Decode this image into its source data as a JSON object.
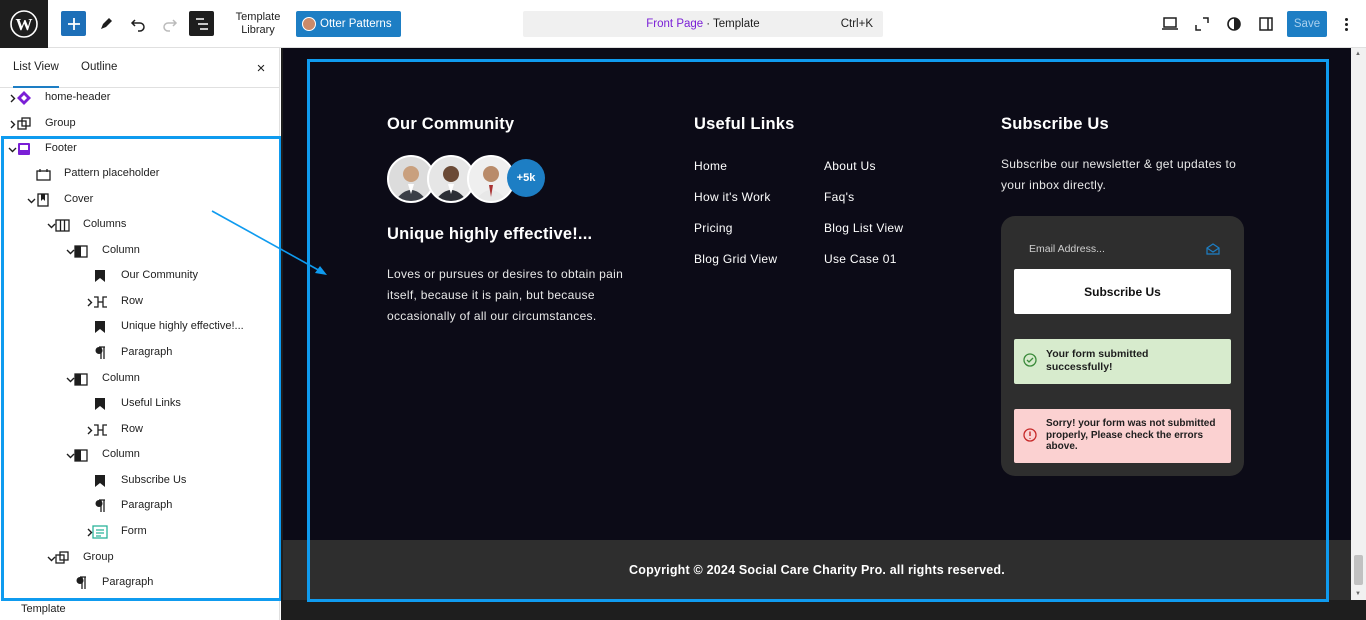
{
  "topbar": {
    "template_library": "Template Library",
    "otter_patterns": "Otter Patterns",
    "command": {
      "page": "Front Page",
      "separator": "·",
      "type": "Template",
      "shortcut": "Ctrl+K"
    },
    "save_label": "Save"
  },
  "sidebar": {
    "tab_list_view": "List View",
    "tab_outline": "Outline",
    "close": "×",
    "tree": [
      {
        "label": "home-header",
        "icon": "diamond-icon"
      },
      {
        "label": "Group",
        "icon": "group-icon"
      },
      {
        "label": "Footer",
        "icon": "footer-icon"
      },
      {
        "label": "Pattern placeholder",
        "icon": "pattern-icon"
      },
      {
        "label": "Cover",
        "icon": "cover-icon"
      },
      {
        "label": "Columns",
        "icon": "columns-icon"
      },
      {
        "label": "Column",
        "icon": "column-icon"
      },
      {
        "label": "Our Community",
        "icon": "bookmark-icon"
      },
      {
        "label": "Row",
        "icon": "row-icon"
      },
      {
        "label": "Unique highly effective!...",
        "icon": "bookmark-icon"
      },
      {
        "label": "Paragraph",
        "icon": "paragraph-icon"
      },
      {
        "label": "Column",
        "icon": "column-icon"
      },
      {
        "label": "Useful Links",
        "icon": "bookmark-icon"
      },
      {
        "label": "Row",
        "icon": "row-icon"
      },
      {
        "label": "Column",
        "icon": "column-icon"
      },
      {
        "label": "Subscribe Us",
        "icon": "bookmark-icon"
      },
      {
        "label": "Paragraph",
        "icon": "paragraph-icon"
      },
      {
        "label": "Form",
        "icon": "form-icon"
      },
      {
        "label": "Group",
        "icon": "group-icon"
      },
      {
        "label": "Paragraph",
        "icon": "paragraph-icon"
      }
    ],
    "status": "Template"
  },
  "footer": {
    "community": {
      "title": "Our Community",
      "plus_badge": "+5k",
      "subtitle": "Unique highly effective!...",
      "text_lines": [
        "Loves or pursues or desires to obtain pain",
        "itself, because it is pain, but because",
        "occasionally of all our circumstances."
      ]
    },
    "links": {
      "title": "Useful Links",
      "col1": [
        "Home",
        "How it's Work",
        "Pricing",
        "Blog Grid View"
      ],
      "col2": [
        "About Us",
        "Faq's",
        "Blog List View",
        "Use Case 01"
      ]
    },
    "subscribe": {
      "title": "Subscribe Us",
      "text_lines": [
        "Subscribe our newsletter & get updates to",
        "your inbox directly."
      ],
      "email_placeholder": "Email Address...",
      "button": "Subscribe Us",
      "success_lines": [
        "Your form submitted",
        "successfully!"
      ],
      "error_lines": [
        "Sorry! your form was not submitted",
        "properly, Please check the errors",
        "above."
      ]
    },
    "copyright": "Copyright © 2024 Social Care Charity Pro. all rights reserved."
  },
  "colors": {
    "accent": "#1d7ec4",
    "selection": "#0f9bef",
    "footer_bg": "#0c0b17"
  }
}
